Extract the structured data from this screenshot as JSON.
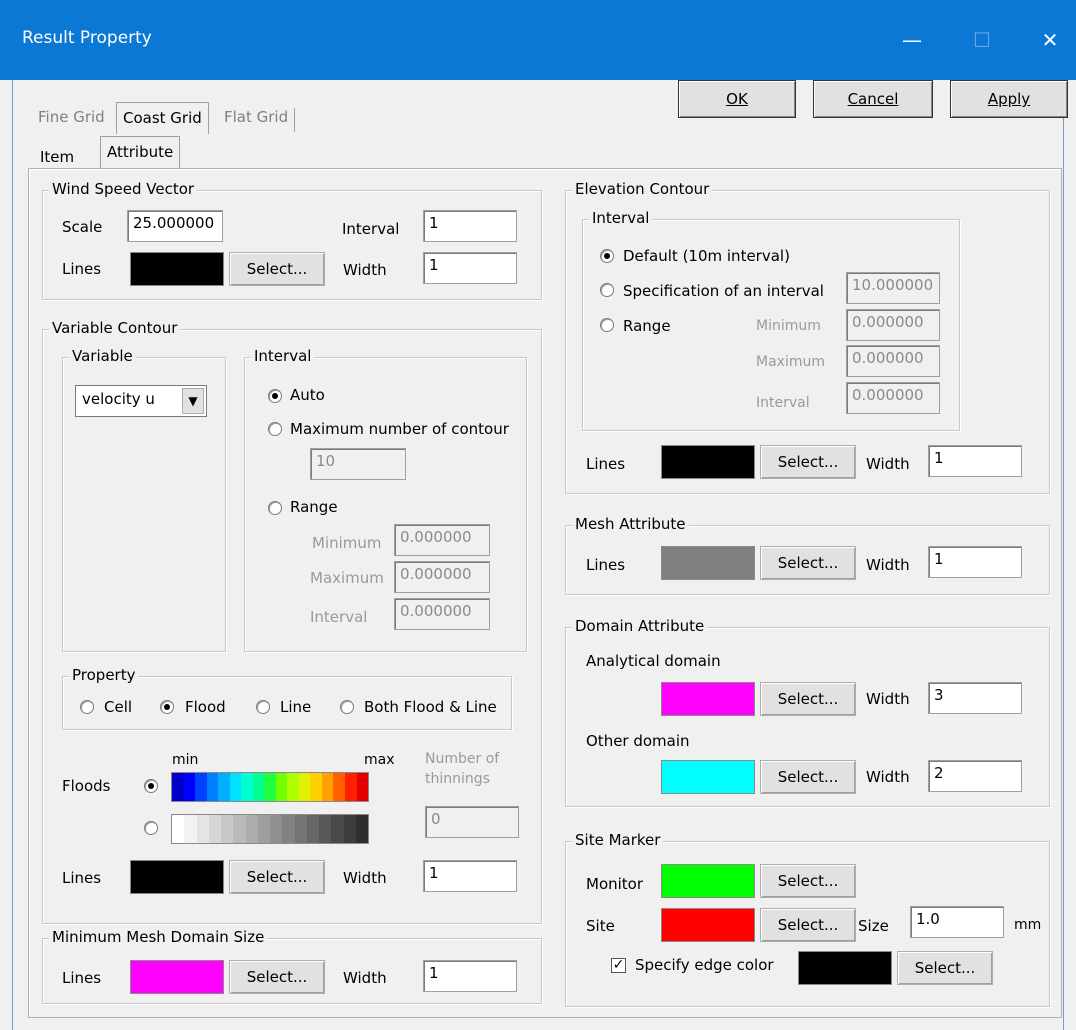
{
  "window": {
    "title": "Result Property",
    "minimize_glyph": "—",
    "maximize_glyph": "☐",
    "close_glyph": "✕"
  },
  "buttons": {
    "ok": "OK",
    "cancel": "Cancel",
    "apply": "Apply",
    "select": "Select..."
  },
  "tabs": [
    "Fine Grid",
    "Coast Grid",
    "Flat Grid"
  ],
  "active_tab": "Coast Grid",
  "subtabs": [
    "Item",
    "Attribute"
  ],
  "active_subtab": "Attribute",
  "wind_speed_vector": {
    "title": "Wind Speed Vector",
    "scale_label": "Scale",
    "scale_value": "25.000000",
    "interval_label": "Interval",
    "interval_value": "1",
    "lines_label": "Lines",
    "lines_color": "#000000",
    "width_label": "Width",
    "width_value": "1"
  },
  "variable_contour": {
    "title": "Variable Contour",
    "variable_group": "Variable",
    "variable_value": "velocity u",
    "interval_group": "Interval",
    "auto_label": "Auto",
    "max_contour_label": "Maximum number of contour",
    "max_contour_value": "10",
    "range_label": "Range",
    "minimum_label": "Minimum",
    "minimum_value": "0.000000",
    "maximum_label": "Maximum",
    "maximum_value": "0.000000",
    "interval_label": "Interval",
    "interval_value": "0.000000",
    "property_group": "Property",
    "prop_cell": "Cell",
    "prop_flood": "Flood",
    "prop_line": "Line",
    "prop_both": "Both Flood & Line",
    "selected_property": "Flood",
    "floods_label": "Floods",
    "min_label": "min",
    "max_label": "max",
    "thinnings_label_1": "Number of",
    "thinnings_label_2": "thinnings",
    "thinnings_value": "0",
    "lines_label": "Lines",
    "lines_color": "#000000",
    "width_label": "Width",
    "width_value": "1",
    "rainbow_colors": [
      "#0000c8",
      "#0000ff",
      "#0040ff",
      "#0080ff",
      "#00b0ff",
      "#00e0ff",
      "#00ffd0",
      "#00ff90",
      "#20ff40",
      "#70ff00",
      "#b0ff00",
      "#e0f000",
      "#ffd000",
      "#ffa000",
      "#ff6000",
      "#ff2000",
      "#e00000"
    ],
    "gray_colors": [
      "#ffffff",
      "#f2f2f2",
      "#e4e4e4",
      "#d6d6d6",
      "#c8c8c8",
      "#bababa",
      "#acacac",
      "#9e9e9e",
      "#909090",
      "#828282",
      "#747474",
      "#666666",
      "#585858",
      "#4a4a4a",
      "#3c3c3c",
      "#2e2e2e"
    ]
  },
  "min_mesh": {
    "title": "Minimum Mesh Domain Size",
    "lines_label": "Lines",
    "lines_color": "#ff00ff",
    "width_label": "Width",
    "width_value": "1"
  },
  "elevation_contour": {
    "title": "Elevation Contour",
    "interval_group": "Interval",
    "default_label": "Default (10m interval)",
    "spec_label": "Specification of an interval",
    "spec_value": "10.000000",
    "range_label": "Range",
    "minimum_label": "Minimum",
    "minimum_value": "0.000000",
    "maximum_label": "Maximum",
    "maximum_value": "0.000000",
    "interval_label": "Interval",
    "interval_value": "0.000000",
    "lines_label": "Lines",
    "lines_color": "#000000",
    "width_label": "Width",
    "width_value": "1"
  },
  "mesh_attribute": {
    "title": "Mesh Attribute",
    "lines_label": "Lines",
    "lines_color": "#808080",
    "width_label": "Width",
    "width_value": "1"
  },
  "domain_attribute": {
    "title": "Domain Attribute",
    "analytical_label": "Analytical domain",
    "analytical_color": "#ff00ff",
    "analytical_width": "3",
    "other_label": "Other domain",
    "other_color": "#00ffff",
    "other_width": "2",
    "width_label": "Width"
  },
  "site_marker": {
    "title": "Site Marker",
    "monitor_label": "Monitor",
    "monitor_color": "#00ff00",
    "site_label": "Site",
    "site_color": "#ff0000",
    "size_label": "Size",
    "size_value": "1.0",
    "size_unit": "mm",
    "edge_label": "Specify edge color",
    "edge_checked": true,
    "edge_color": "#000000"
  }
}
